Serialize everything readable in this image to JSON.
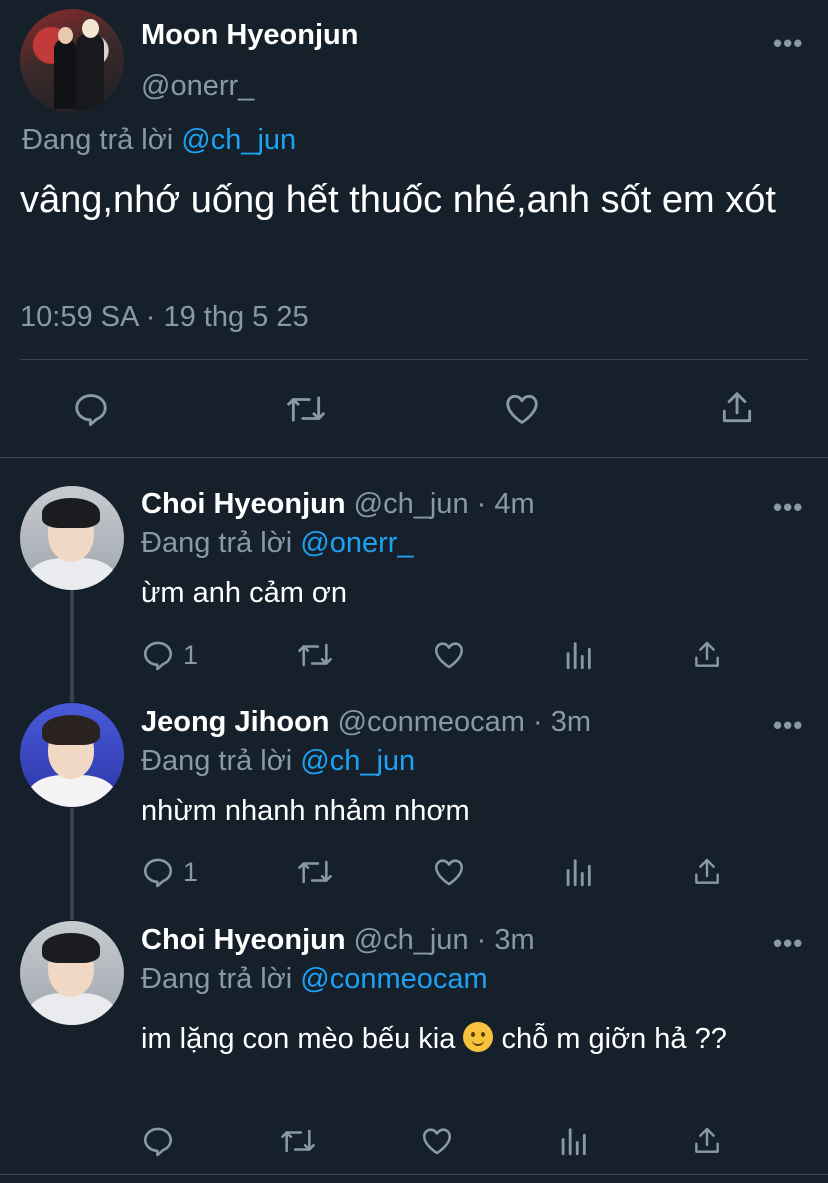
{
  "main_tweet": {
    "author_name": "Moon Hyeonjun",
    "author_handle": "@onerr_",
    "replying_prefix": "Đang trả lời ",
    "replying_to": "@ch_jun",
    "text": "vâng,nhớ uống hết thuốc nhé,anh sốt em xót",
    "timestamp": "10:59 SA · 19 thg 5 25",
    "actions": [
      "reply-icon",
      "retweet-icon",
      "like-icon",
      "share-icon"
    ]
  },
  "replies": [
    {
      "author_name": "Choi Hyeonjun",
      "meta": "@ch_jun · 4m",
      "replying_prefix": "Đang trả lời ",
      "replying_to": "@onerr_",
      "text": "ừm anh cảm ơn",
      "reply_count": "1"
    },
    {
      "author_name": "Jeong Jihoon",
      "meta": "@conmeocam · 3m",
      "replying_prefix": "Đang trả lời ",
      "replying_to": "@ch_jun",
      "text": "nhừm nhanh nhảm nhơm",
      "reply_count": "1"
    },
    {
      "author_name": "Choi Hyeonjun",
      "meta": "@ch_jun · 3m",
      "replying_prefix": "Đang trả lời ",
      "replying_to": "@conmeocam",
      "text_before_emoji": "im lặng con mèo bếu kia ",
      "emoji": "slightly-smiling-face",
      "text_after_emoji": "  chỗ m giỡn hả ??",
      "reply_count": ""
    }
  ],
  "more_glyph": "•••",
  "colors": {
    "background": "#15202b",
    "secondary_text": "#8899a6",
    "link": "#1da1f2",
    "divider": "#38444d"
  }
}
